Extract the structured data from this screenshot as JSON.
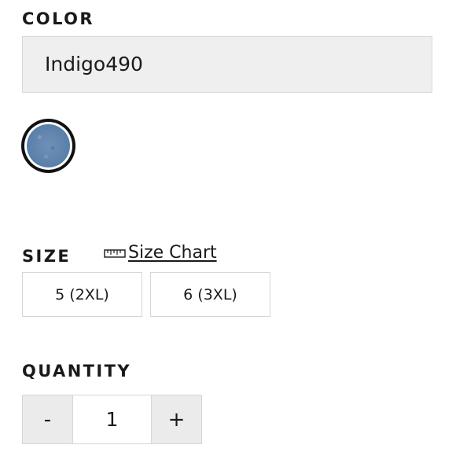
{
  "color": {
    "label": "COLOR",
    "selected_value": "Indigo490",
    "swatch": {
      "name": "Indigo490",
      "hex": "#5f84ad",
      "selected": true
    }
  },
  "size": {
    "label": "SIZE",
    "size_chart": {
      "label": "Size Chart",
      "icon": "ruler-icon"
    },
    "options": [
      {
        "label": "5 (2XL)"
      },
      {
        "label": "6 (3XL)"
      }
    ]
  },
  "quantity": {
    "label": "QUANTITY",
    "decrement_label": "-",
    "value": "1",
    "increment_label": "+"
  }
}
